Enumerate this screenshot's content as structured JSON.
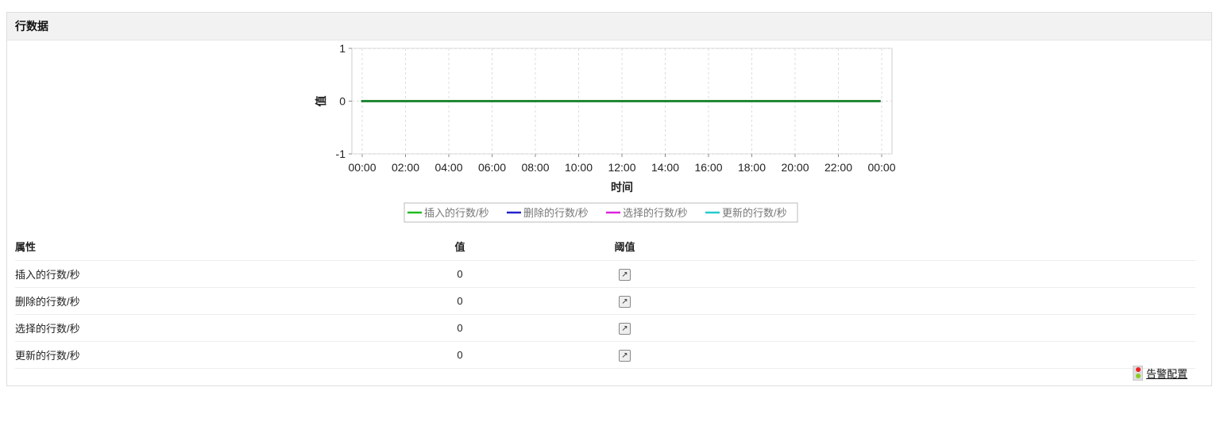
{
  "panel": {
    "title": "行数据"
  },
  "chart_data": {
    "type": "line",
    "xlabel": "时间",
    "ylabel": "值",
    "ylim": [
      -1,
      1
    ],
    "yticks": [
      "1",
      "0",
      "-1"
    ],
    "xticks": [
      "00:00",
      "02:00",
      "04:00",
      "06:00",
      "08:00",
      "10:00",
      "12:00",
      "14:00",
      "16:00",
      "18:00",
      "20:00",
      "22:00",
      "00:00"
    ],
    "xrange_hours": [
      0,
      24
    ],
    "grid": true,
    "legend_position": "bottom",
    "series": [
      {
        "name": "插入的行数/秒",
        "color": "#22bb22",
        "x_hours": [
          0,
          23.9
        ],
        "values": [
          0,
          0
        ]
      },
      {
        "name": "删除的行数/秒",
        "color": "#2222cc",
        "x_hours": [
          0,
          23.9
        ],
        "values": [
          0,
          0
        ]
      },
      {
        "name": "选择的行数/秒",
        "color": "#dd22dd",
        "x_hours": [
          0,
          23.9
        ],
        "values": [
          0,
          0
        ]
      },
      {
        "name": "更新的行数/秒",
        "color": "#22cccc",
        "x_hours": [
          0,
          23.9
        ],
        "values": [
          0,
          0
        ]
      }
    ]
  },
  "table": {
    "headers": [
      "属性",
      "值",
      "阈值"
    ],
    "rows": [
      {
        "name": "插入的行数/秒",
        "value": "0"
      },
      {
        "name": "删除的行数/秒",
        "value": "0"
      },
      {
        "name": "选择的行数/秒",
        "value": "0"
      },
      {
        "name": "更新的行数/秒",
        "value": "0"
      }
    ]
  },
  "alarm": {
    "label": "告警配置",
    "icon": "traffic-light-icon"
  },
  "threshold_icon": "threshold-edit-icon"
}
